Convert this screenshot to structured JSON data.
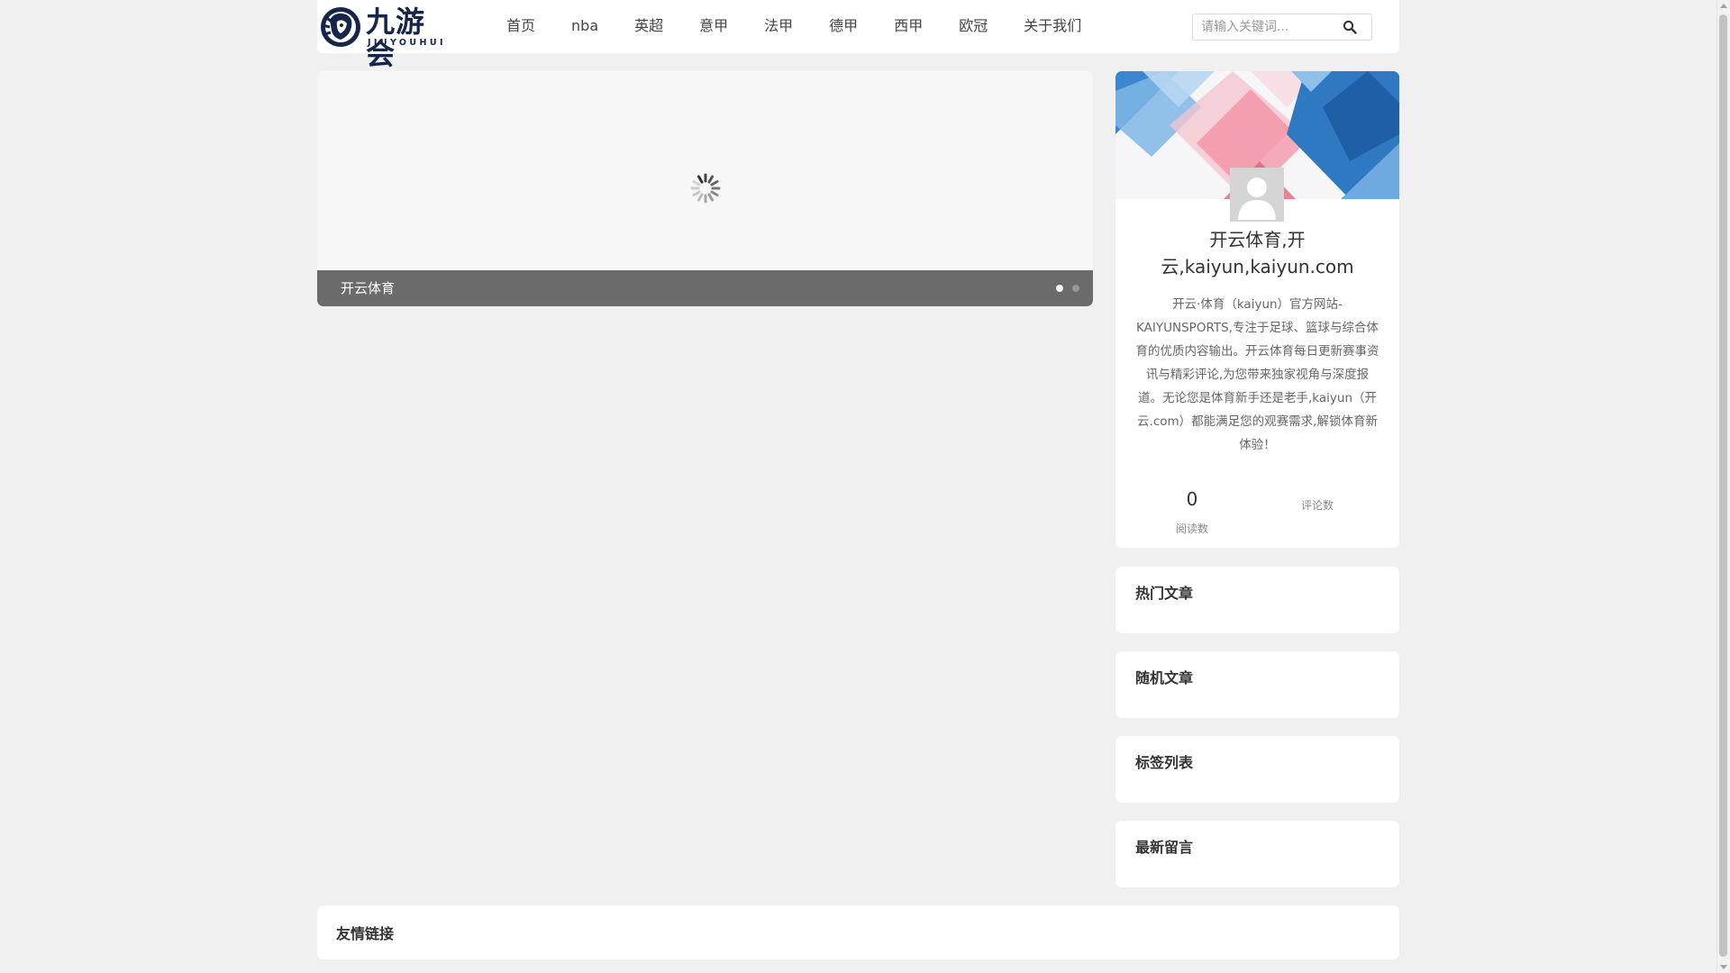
{
  "header": {
    "logo": {
      "text": "九游会",
      "subtext": "JIUYOUHUI"
    },
    "nav": [
      {
        "label": "首页"
      },
      {
        "label": "nba"
      },
      {
        "label": "英超"
      },
      {
        "label": "意甲"
      },
      {
        "label": "法甲"
      },
      {
        "label": "德甲"
      },
      {
        "label": "西甲"
      },
      {
        "label": "欧冠"
      },
      {
        "label": "关于我们"
      }
    ],
    "search": {
      "placeholder": "请输入关键词...",
      "icon": "search-icon"
    }
  },
  "slider": {
    "caption": "开云体育",
    "slide_count": 2,
    "active_index": 0,
    "loading_icon": "spinner-icon"
  },
  "profile": {
    "avatar_icon": "user-avatar-icon",
    "site_name": "开云体育,开云,kaiyun,kaiyun.com",
    "description": "开云·体育（kaiyun）官方网站-KAIYUNSPORTS,专注于足球、篮球与综合体育的优质内容输出。开云体育每日更新赛事资讯与精彩评论,为您带来独家视角与深度报道。无论您是体育新手还是老手,kaiyun（开云.com）都能满足您的观赛需求,解锁体育新体验！",
    "stats": {
      "read_count": "0",
      "read_label": "阅读数",
      "comment_label": "评论数"
    }
  },
  "widgets": {
    "hot": "热门文章",
    "random": "随机文章",
    "tags": "标签列表",
    "latest_comments": "最新留言"
  },
  "friend_links": {
    "title": "友情链接"
  },
  "colors": {
    "page_bg": "#f0f0f0",
    "logo_navy": "#16264a",
    "caption_bar": "#6b6b6b",
    "banner_blue": "#2f79c2",
    "banner_pink": "#f28aa0"
  }
}
